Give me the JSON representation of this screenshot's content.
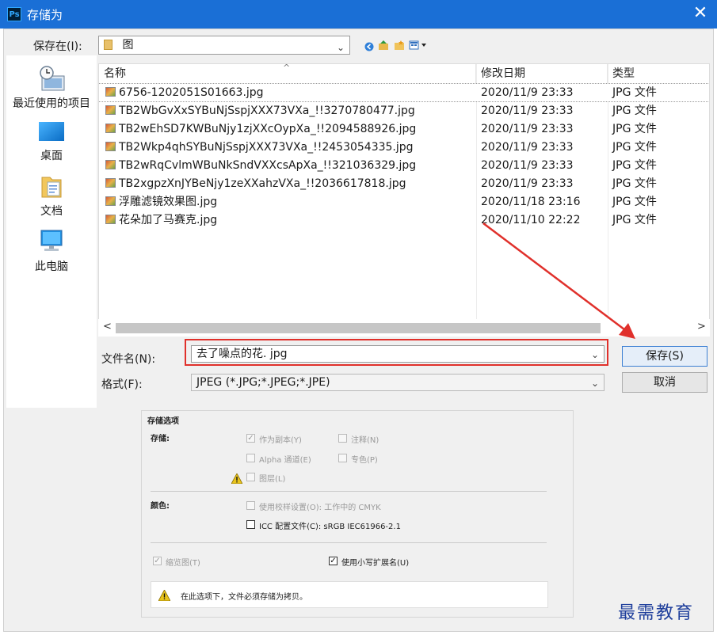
{
  "window": {
    "title": "存储为",
    "app_icon_text": "Ps",
    "close_glyph": "✕"
  },
  "save_in": {
    "label": "保存在(I):",
    "value": "图"
  },
  "places": [
    {
      "label": "最近使用的项目",
      "icon": "recent-places-icon"
    },
    {
      "label": "桌面",
      "icon": "desktop-icon"
    },
    {
      "label": "文档",
      "icon": "documents-icon"
    },
    {
      "label": "此电脑",
      "icon": "this-pc-icon"
    }
  ],
  "file_list": {
    "columns": [
      "名称",
      "修改日期",
      "类型"
    ],
    "rows": [
      {
        "name": "6756-1202051S01663.jpg",
        "date": "2020/11/9 23:33",
        "type": "JPG 文件"
      },
      {
        "name": "TB2WbGvXxSYBuNjSspjXXX73VXa_!!3270780477.jpg",
        "date": "2020/11/9 23:33",
        "type": "JPG 文件"
      },
      {
        "name": "TB2wEhSD7KWBuNjy1zjXXcOypXa_!!2094588926.jpg",
        "date": "2020/11/9 23:33",
        "type": "JPG 文件"
      },
      {
        "name": "TB2Wkp4qhSYBuNjSspjXXX73VXa_!!2453054335.jpg",
        "date": "2020/11/9 23:33",
        "type": "JPG 文件"
      },
      {
        "name": "TB2wRqCvlmWBuNkSndVXXcsApXa_!!321036329.jpg",
        "date": "2020/11/9 23:33",
        "type": "JPG 文件"
      },
      {
        "name": "TB2xgpzXnJYBeNjy1zeXXahzVXa_!!2036617818.jpg",
        "date": "2020/11/9 23:33",
        "type": "JPG 文件"
      },
      {
        "name": "浮雕滤镜效果图.jpg",
        "date": "2020/11/18 23:16",
        "type": "JPG 文件"
      },
      {
        "name": "花朵加了马赛克.jpg",
        "date": "2020/11/10 22:22",
        "type": "JPG 文件"
      }
    ]
  },
  "scroll": {
    "left": "<",
    "right": ">"
  },
  "filename": {
    "label": "文件名(N):",
    "value": "去了噪点的花. jpg"
  },
  "format": {
    "label": "格式(F):",
    "value": "JPEG (*.JPG;*.JPEG;*.JPE)"
  },
  "buttons": {
    "save": "保存(S)",
    "cancel": "取消"
  },
  "options": {
    "group_title": "存储选项",
    "save_label": "存储:",
    "as_copy": "作为副本(Y)",
    "notes": "注释(N)",
    "alpha": "Alpha 通道(E)",
    "spot": "专色(P)",
    "layers": "图层(L)",
    "color_label": "颜色:",
    "use_proof": "使用校样设置(O): 工作中的 CMYK",
    "icc": "ICC 配置文件(C): sRGB IEC61966-2.1",
    "thumbnail": "缩览图(T)",
    "lowercase_ext": "使用小写扩展名(U)",
    "warning": "在此选项下，文件必须存储为拷贝。"
  },
  "watermark": "最需教育",
  "colors": {
    "title_bar": "#1a6fd6",
    "highlight_border": "#e0302b",
    "arrow": "#e0302b"
  }
}
